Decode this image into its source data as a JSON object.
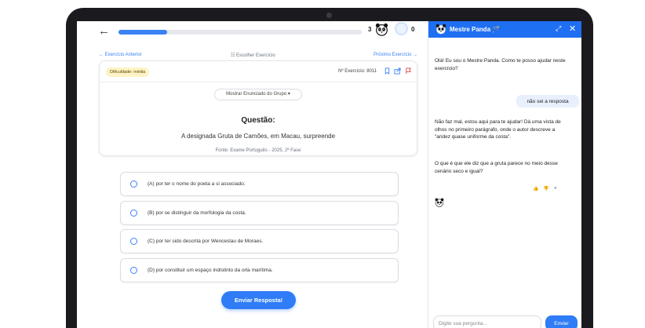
{
  "topbar": {
    "progress": 0.2,
    "streak_count": "3",
    "coin_count": "0",
    "back_icon": "arrow-left-icon"
  },
  "nav": {
    "previous": "← Exercício Anterior",
    "choose": "☷ Escolher Exercício",
    "next": "Próximo Exercício →"
  },
  "question": {
    "difficulty": "Dificuldade: média",
    "exercise_number": "Nº Exercício: 8011",
    "group_button": "Mostrar Enunciado do Grupo ▾",
    "heading": "Questão:",
    "text": "A designada Gruta de Camões, em Macau, surpreende",
    "source": "Fonte: Exame Português - 2025, 2ª Fase"
  },
  "options": [
    {
      "label": "(A) por ter o nome do poeta a si associado."
    },
    {
      "label": "(B) por se distinguir da morfologia da costa."
    },
    {
      "label": "(C) por ter sido descrita por Wenceslau de Moraes."
    },
    {
      "label": "(D) por constituir um espaço indistinto da orla marítima."
    }
  ],
  "submit_label": "Enviar Resposta!",
  "chat": {
    "title": "Mestre Panda 🪄",
    "messages": {
      "bot_greeting": "Olá! Eu sou o Mestre Panda. Como te posso ajudar neste exercício?",
      "user_reply": "não sei a resposta",
      "bot_hint": "Não faz mal, estou aqui para te ajudar! Dá uma vista de olhos no primeiro parágrafo, onde o autor descreve a \"aridez quase uniforme da costa\".",
      "bot_question": "O que é que ele diz que a gruta parece no meio desse cenário seco e igual?"
    },
    "input_placeholder": "Digite sua pergunta...",
    "send_label": "Enviar"
  },
  "colors": {
    "accent": "#2f7cf6",
    "header": "#1f6ff2",
    "difficulty_bg": "#fdf3c4",
    "user_bubble": "#e8f0fe"
  }
}
